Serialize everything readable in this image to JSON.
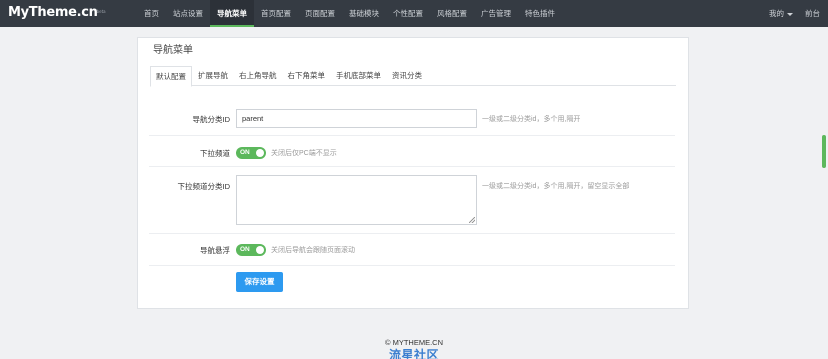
{
  "header": {
    "logo": "MyTheme.cn",
    "logo_sup": "beta",
    "nav": [
      {
        "label": "首页",
        "active": false
      },
      {
        "label": "站点设置",
        "active": false
      },
      {
        "label": "导航菜单",
        "active": true
      },
      {
        "label": "首页配置",
        "active": false
      },
      {
        "label": "页面配置",
        "active": false
      },
      {
        "label": "基础模块",
        "active": false
      },
      {
        "label": "个性配置",
        "active": false
      },
      {
        "label": "风格配置",
        "active": false
      },
      {
        "label": "广告管理",
        "active": false
      },
      {
        "label": "特色插件",
        "active": false
      }
    ],
    "user_menu": "我的",
    "frontend_link": "前台"
  },
  "panel": {
    "title": "导航菜单",
    "tabs": [
      "默认配置",
      "扩展导航",
      "右上角导航",
      "右下角菜单",
      "手机底部菜单",
      "资讯分类"
    ],
    "active_tab": 0
  },
  "form": {
    "nav_category": {
      "label": "导航分类ID",
      "value": "parent",
      "hint": "一级或二级分类id，多个用,隔开"
    },
    "dropdown_channel": {
      "label": "下拉频道",
      "toggle": "ON",
      "hint": "关闭后仅PC端不显示"
    },
    "dropdown_category": {
      "label": "下拉频道分类ID",
      "value": "",
      "hint": "一级或二级分类id，多个用,隔开，留空显示全部"
    },
    "nav_float": {
      "label": "导航悬浮",
      "toggle": "ON",
      "hint": "关闭后导航会跟随页面滚动"
    },
    "save_label": "保存设置"
  },
  "footer": {
    "copyright": "© MYTHEME.CN",
    "watermark": "流星社区"
  },
  "colors": {
    "topbar": "#353b43",
    "accent_green": "#5cb85c",
    "button_blue": "#2d9af0"
  }
}
